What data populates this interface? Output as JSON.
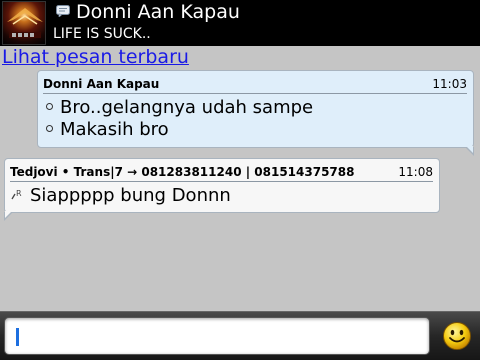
{
  "header": {
    "contact_name": "Donni Aan Kapau",
    "status_message": "LIFE IS SUCK.."
  },
  "link": {
    "latest_messages": "Lihat pesan terbaru"
  },
  "messages": [
    {
      "sender": "Donni Aan Kapau",
      "time": "11:03",
      "lines": [
        "Bro..gelangnya udah sampe",
        "Makasih bro"
      ]
    },
    {
      "sender": "Tedjovi • Trans|7 → 081283811240 | 081514375788",
      "time": "11:08",
      "lines": [
        "Siappppp bung Donnn"
      ],
      "status_icon": "read-r-icon"
    }
  ],
  "composer": {
    "value": "",
    "emoticon_icon": "smiley-icon"
  },
  "colors": {
    "background": "#c5c5c5",
    "header": "#000000",
    "incoming_bubble": "#dfeefa",
    "outgoing_bubble": "#f7f7f7",
    "link": "#1a1ae6",
    "cursor": "#1d6fe0"
  }
}
